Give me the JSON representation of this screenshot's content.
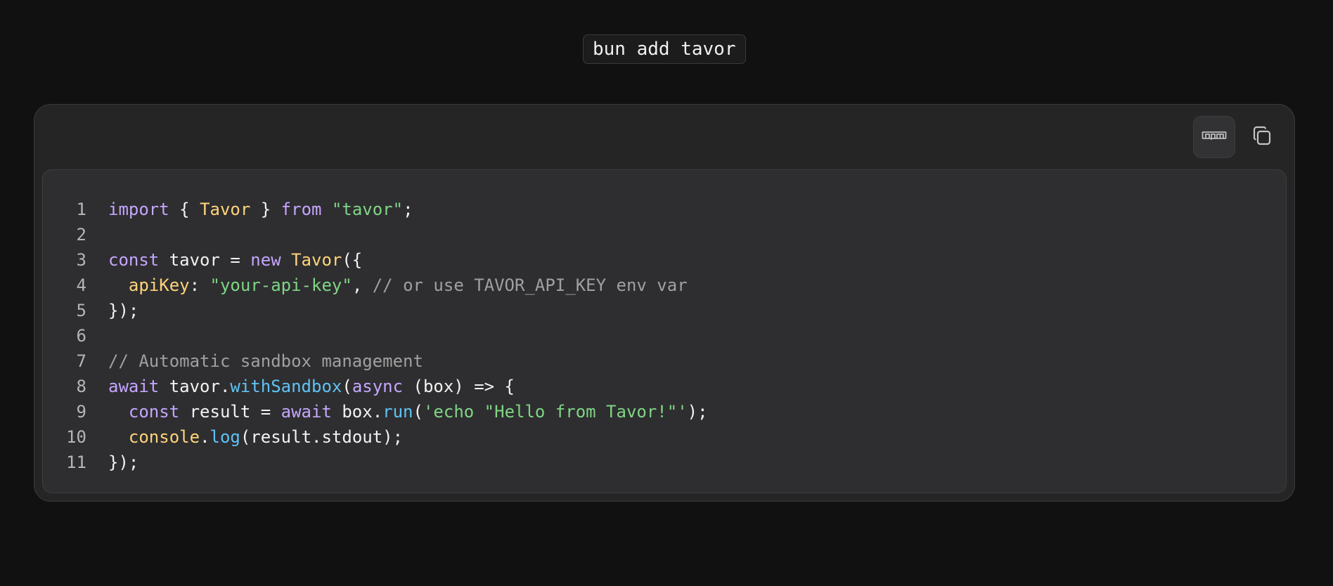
{
  "install_command": "bun add tavor",
  "toolbar": {
    "package_manager_icon": "npm-icon",
    "copy_icon": "copy-icon"
  },
  "colors": {
    "background": "#111111",
    "card": "#252526",
    "panel": "#2e2e30",
    "keyword": "#c5a5ff",
    "type": "#ffd47a",
    "string": "#7fd584",
    "comment": "#a0a0a0",
    "function": "#5fc3f5"
  },
  "code": {
    "lines": [
      {
        "n": "1",
        "tokens": [
          {
            "t": "import",
            "c": "kw"
          },
          {
            "t": " { ",
            "c": "pl"
          },
          {
            "t": "Tavor",
            "c": "ty"
          },
          {
            "t": " } ",
            "c": "pl"
          },
          {
            "t": "from",
            "c": "kw"
          },
          {
            "t": " ",
            "c": "pl"
          },
          {
            "t": "\"tavor\"",
            "c": "st"
          },
          {
            "t": ";",
            "c": "pl"
          }
        ]
      },
      {
        "n": "2",
        "tokens": []
      },
      {
        "n": "3",
        "tokens": [
          {
            "t": "const",
            "c": "kw"
          },
          {
            "t": " tavor = ",
            "c": "pl"
          },
          {
            "t": "new",
            "c": "kw"
          },
          {
            "t": " ",
            "c": "pl"
          },
          {
            "t": "Tavor",
            "c": "ty"
          },
          {
            "t": "({",
            "c": "pl"
          }
        ]
      },
      {
        "n": "4",
        "tokens": [
          {
            "t": "  ",
            "c": "pl"
          },
          {
            "t": "apiKey",
            "c": "ty"
          },
          {
            "t": ": ",
            "c": "pl"
          },
          {
            "t": "\"your-api-key\"",
            "c": "st"
          },
          {
            "t": ", ",
            "c": "pl"
          },
          {
            "t": "// or use TAVOR_API_KEY env var",
            "c": "cm"
          }
        ]
      },
      {
        "n": "5",
        "tokens": [
          {
            "t": "});",
            "c": "pl"
          }
        ]
      },
      {
        "n": "6",
        "tokens": []
      },
      {
        "n": "7",
        "tokens": [
          {
            "t": "// Automatic sandbox management",
            "c": "cm"
          }
        ]
      },
      {
        "n": "8",
        "tokens": [
          {
            "t": "await",
            "c": "kw"
          },
          {
            "t": " tavor.",
            "c": "pl"
          },
          {
            "t": "withSandbox",
            "c": "fn"
          },
          {
            "t": "(",
            "c": "pl"
          },
          {
            "t": "async",
            "c": "kw"
          },
          {
            "t": " (box) => {",
            "c": "pl"
          }
        ]
      },
      {
        "n": "9",
        "tokens": [
          {
            "t": "  ",
            "c": "pl"
          },
          {
            "t": "const",
            "c": "kw"
          },
          {
            "t": " result = ",
            "c": "pl"
          },
          {
            "t": "await",
            "c": "kw"
          },
          {
            "t": " box.",
            "c": "pl"
          },
          {
            "t": "run",
            "c": "fn"
          },
          {
            "t": "(",
            "c": "pl"
          },
          {
            "t": "'echo \"Hello from Tavor!\"'",
            "c": "st"
          },
          {
            "t": ");",
            "c": "pl"
          }
        ]
      },
      {
        "n": "10",
        "tokens": [
          {
            "t": "  ",
            "c": "pl"
          },
          {
            "t": "console",
            "c": "ty"
          },
          {
            "t": ".",
            "c": "pl"
          },
          {
            "t": "log",
            "c": "fn"
          },
          {
            "t": "(result.stdout);",
            "c": "pl"
          }
        ]
      },
      {
        "n": "11",
        "tokens": [
          {
            "t": "});",
            "c": "pl"
          }
        ]
      }
    ]
  }
}
